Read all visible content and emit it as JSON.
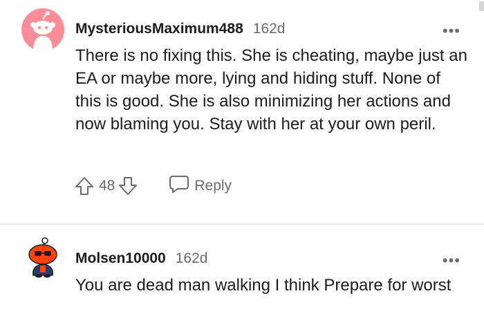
{
  "comments": [
    {
      "username": "MysteriousMaximum488",
      "age": "162d",
      "more_label": "•••",
      "body": "There is no fixing this. She is cheating, maybe just an EA or maybe more, lying and hiding stuff. None of this is good. She is also minimizing her actions and now blaming you. Stay with her at your own peril.",
      "score": "48",
      "reply_label": "Reply",
      "avatar_color": "#ff8c96"
    },
    {
      "username": "Molsen10000",
      "age": "162d",
      "more_label": "•••",
      "body": "You are dead man walking I think Prepare for worst",
      "avatar_color": "#ff4500"
    }
  ],
  "icons": {
    "upvote": "arrow-up-icon",
    "downvote": "arrow-down-icon",
    "reply": "speech-bubble-icon",
    "more": "ellipsis-icon"
  }
}
